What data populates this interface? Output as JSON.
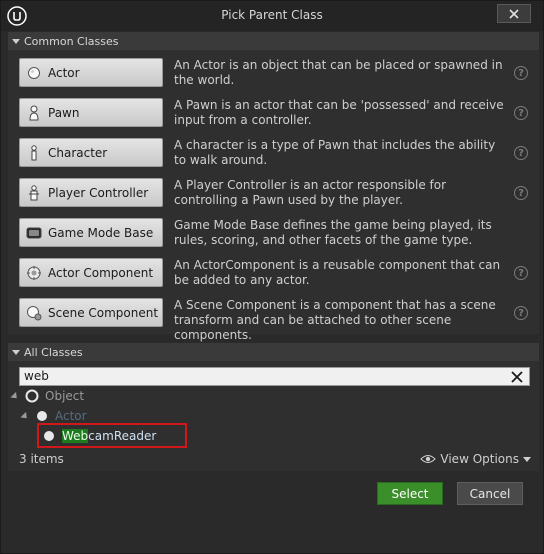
{
  "window": {
    "title": "Pick Parent Class"
  },
  "common": {
    "header": "Common Classes",
    "items": [
      {
        "label": "Actor",
        "icon": "actor-icon",
        "desc": "An Actor is an object that can be placed or spawned in the world."
      },
      {
        "label": "Pawn",
        "icon": "pawn-icon",
        "desc": "A Pawn is an actor that can be 'possessed' and receive input from a controller."
      },
      {
        "label": "Character",
        "icon": "character-icon",
        "desc": "A character is a type of Pawn that includes the ability to walk around."
      },
      {
        "label": "Player Controller",
        "icon": "player-controller-icon",
        "desc": "A Player Controller is an actor responsible for controlling a Pawn used by the player."
      },
      {
        "label": "Game Mode Base",
        "icon": "game-mode-icon",
        "desc": "Game Mode Base defines the game being played, its rules, scoring, and other facets of the game type."
      },
      {
        "label": "Actor Component",
        "icon": "actor-component-icon",
        "desc": "An ActorComponent is a reusable component that can be added to any actor."
      },
      {
        "label": "Scene Component",
        "icon": "scene-component-icon",
        "desc": "A Scene Component is a component that has a scene transform and can be attached to other scene components."
      }
    ]
  },
  "all": {
    "header": "All Classes",
    "search_value": "web",
    "tree": [
      {
        "label": "Object"
      },
      {
        "label": "Actor"
      },
      {
        "label_match": "Web",
        "label_rest": "camReader"
      }
    ],
    "items_count": "3 items",
    "view_options": "View Options"
  },
  "footer": {
    "select": "Select",
    "cancel": "Cancel"
  },
  "colors": {
    "accent_green": "#3a8f2a",
    "highlight_red": "#d0181a",
    "search_match": "#1e7a1e"
  }
}
